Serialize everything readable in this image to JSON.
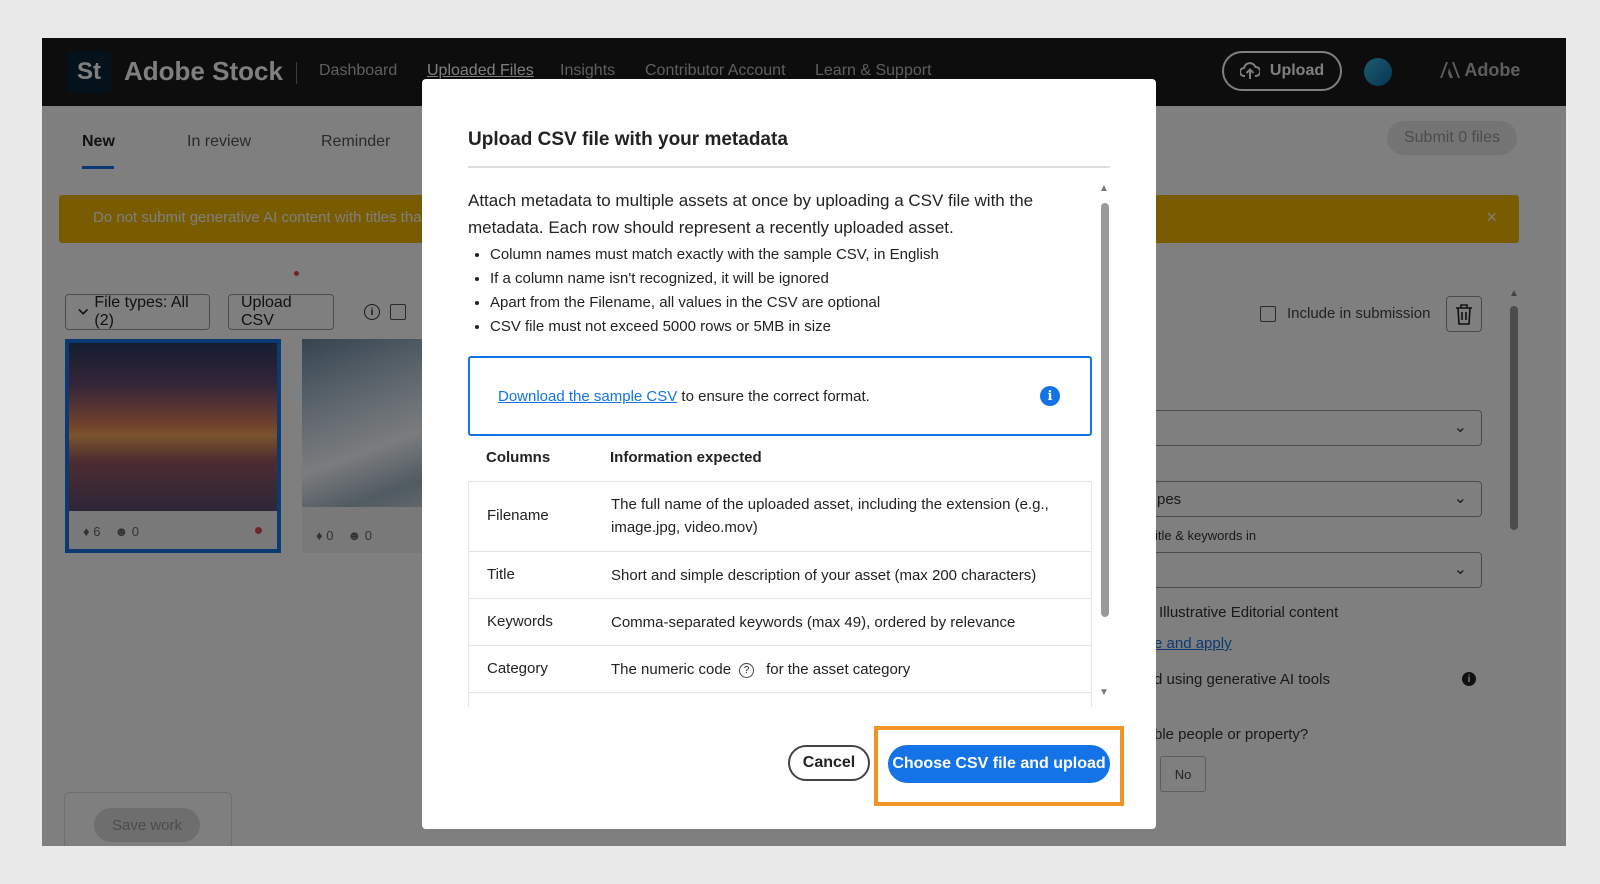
{
  "app": {
    "logo_text": "St",
    "brand": "Adobe Stock",
    "adobe_label": "Adobe",
    "nav": [
      "Dashboard",
      "Uploaded Files",
      "Insights",
      "Contributor Account",
      "Learn & Support"
    ],
    "upload_label": "Upload"
  },
  "tabs": [
    "New",
    "In review",
    "Reminder"
  ],
  "submit_label": "Submit 0 files",
  "warning": {
    "text": "Do not submit generative AI content with titles tha",
    "close": "×"
  },
  "filters": {
    "file_types": "File types: All (2)",
    "upload_csv": "Upload CSV"
  },
  "thumbs": [
    {
      "tags": "6",
      "people": "0"
    },
    {
      "tags": "0",
      "people": "0"
    }
  ],
  "side_panel": {
    "include_label": "Include in submission",
    "type_select": "pes",
    "title_keywords_label": "itle & keywords in",
    "illustrative_text": "Illustrative Editorial content",
    "link_text": "e and apply",
    "genai_text": "d using generative AI tools",
    "people_text": "ble people or property?",
    "no_label": "No",
    "save_label": "Save work"
  },
  "modal": {
    "title": "Upload CSV file with your metadata",
    "intro": "Attach metadata to multiple assets at once by uploading a CSV file with the metadata. Each row should represent a recently uploaded asset.",
    "bullets": [
      "Column names must match exactly with the sample CSV, in English",
      "If a column name isn't recognized, it will be ignored",
      "Apart from the Filename, all values in the CSV are optional",
      "CSV file must not exceed 5000 rows or 5MB in size"
    ],
    "info_link": "Download the sample CSV",
    "info_rest": " to ensure the correct format.",
    "table_headers": [
      "Columns",
      "Information expected"
    ],
    "rows": [
      {
        "col": "Filename",
        "info": "The full name of the uploaded asset, including the extension (e.g., image.jpg, video.mov)"
      },
      {
        "col": "Title",
        "info": "Short and simple description of your asset (max 200 characters)"
      },
      {
        "col": "Keywords",
        "info": "Comma-separated keywords (max 49), ordered by relevance"
      },
      {
        "col": "Category",
        "info_a": "The numeric code",
        "info_b": "for the asset category"
      }
    ],
    "cancel_label": "Cancel",
    "primary_label": "Choose CSV file and upload"
  }
}
